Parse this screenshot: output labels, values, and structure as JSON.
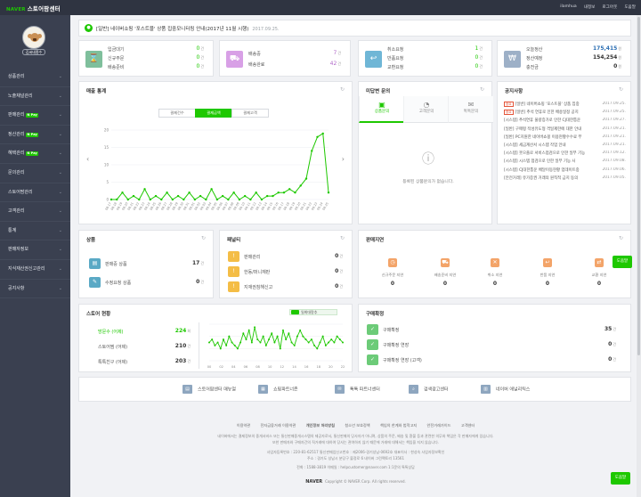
{
  "header": {
    "brand_logo": "NAVER",
    "app_title": "스토어팜센터",
    "user_id": "ilamhua",
    "links": [
      "내정보",
      "로그아웃",
      "도움말"
    ]
  },
  "sidebar": {
    "shop_name": "김씨네종수",
    "items": [
      {
        "label": "상품관리",
        "pay": ""
      },
      {
        "label": "노출채널관리",
        "pay": ""
      },
      {
        "label": "판매관리",
        "pay": "N Pay"
      },
      {
        "label": "정산관리",
        "pay": "N Pay"
      },
      {
        "label": "혜택관리",
        "pay": "N Pay"
      },
      {
        "label": "문의관리",
        "pay": ""
      },
      {
        "label": "스토어팜관리",
        "pay": ""
      },
      {
        "label": "고객관리",
        "pay": ""
      },
      {
        "label": "통계",
        "pay": ""
      },
      {
        "label": "판매자정보",
        "pay": ""
      },
      {
        "label": "지식재산권신고관리",
        "pay": ""
      },
      {
        "label": "공지사항",
        "pay": ""
      }
    ]
  },
  "notice": {
    "icon": "bell-icon",
    "text": "[일반] 네이버쇼핑 '포스트블' 상품 집중모니터링 안내(2017년 11월 시행)",
    "date": "2017.09.25."
  },
  "summary": {
    "orders": {
      "icon": "hourglass-icon",
      "color": "#7fbf9c",
      "rows": [
        {
          "label": "입금대기",
          "value": "0",
          "unit": "건"
        },
        {
          "label": "신규주문",
          "value": "0",
          "unit": "건"
        },
        {
          "label": "배송준비",
          "value": "0",
          "unit": "건"
        }
      ]
    },
    "shipping": {
      "icon": "truck-icon",
      "color": "#d8a0e6",
      "rows": [
        {
          "label": "배송중",
          "value": "7",
          "unit": "건"
        },
        {
          "label": "배송완료",
          "value": "42",
          "unit": "건"
        }
      ]
    },
    "claims": {
      "icon": "return-icon",
      "color": "#6fb6d6",
      "rows": [
        {
          "label": "취소요청",
          "value": "1",
          "unit": "건"
        },
        {
          "label": "반품요청",
          "value": "0",
          "unit": "건"
        },
        {
          "label": "교환요청",
          "value": "0",
          "unit": "건"
        }
      ]
    },
    "settlement": {
      "icon": "won-icon",
      "color": "#9db0c7",
      "rows": [
        {
          "label": "오늘정산",
          "value": "175,415",
          "unit": "원"
        },
        {
          "label": "정산예정",
          "value": "154,254",
          "unit": "원"
        },
        {
          "label": "충전금",
          "value": "0",
          "unit": "원"
        }
      ]
    }
  },
  "sales_stats": {
    "title": "매출 통계",
    "tabs": [
      "결제건수",
      "결제금액",
      "결제고객"
    ],
    "active_tab": 1
  },
  "chart_data": {
    "type": "line",
    "title": "매출 통계",
    "x": [
      "08.17",
      "08.18",
      "08.19",
      "08.20",
      "08.21",
      "08.22",
      "08.23",
      "08.24",
      "08.25",
      "08.26",
      "08.27",
      "08.28",
      "08.29",
      "08.30",
      "08.31",
      "09.01",
      "09.02",
      "09.03",
      "09.04",
      "09.05",
      "09.06",
      "09.07",
      "09.08",
      "09.09",
      "09.10",
      "09.11",
      "09.12",
      "09.13",
      "09.14",
      "09.15",
      "09.16",
      "09.17",
      "09.18",
      "09.19",
      "09.20",
      "09.21",
      "09.22",
      "09.23",
      "09.24",
      "09.25"
    ],
    "series": [
      {
        "values": [
          0,
          0,
          2,
          0,
          1,
          0,
          3,
          0,
          1,
          0,
          2,
          0,
          1,
          0,
          2,
          0,
          1,
          0,
          3,
          0,
          1,
          0,
          2,
          0,
          1,
          0,
          2,
          0,
          1,
          1,
          2,
          2,
          3,
          2,
          4,
          6,
          14,
          18,
          19,
          2
        ]
      }
    ],
    "ylim": [
      0,
      20
    ],
    "yticks": [
      0,
      5,
      10,
      15,
      20
    ],
    "color": "#1ec800"
  },
  "inquiries": {
    "title": "미답변 문의",
    "tabs": [
      "상품문의",
      "고객문의",
      "톡톡문의"
    ],
    "tab_icons": [
      "box-icon",
      "chat-icon",
      "talk-icon"
    ],
    "empty_text": "등록된 상품문의가 없습니다."
  },
  "announcements": {
    "title": "공지사항",
    "items": [
      {
        "tag": "중요",
        "text": "[일반] 네이버쇼핑 '포스트블' 상품 집중",
        "date": "2017.09.25."
      },
      {
        "tag": "중요",
        "text": "[일반] 추석 연휴로 인한 배송일정 공지",
        "date": "2017.09.25."
      },
      {
        "tag": "",
        "text": "[시스템] 추석연휴 물량증가로 인한 CJ대한통운",
        "date": "2017.09.27."
      },
      {
        "tag": "",
        "text": "[일반] 구매평 작성유도형 격일제한에 대한 안내",
        "date": "2017.09.21."
      },
      {
        "tag": "",
        "text": "[일반] PC지원한 네이버쇼핑 이용현황수수료 부",
        "date": "2017.09.21."
      },
      {
        "tag": "",
        "text": "[시스템] 세금계산서 시스템 작업 안내",
        "date": "2017.09.21."
      },
      {
        "tag": "",
        "text": "[시스템] 웃으플로 서비스점검으로 인한 일부 기능",
        "date": "2017.09.12."
      },
      {
        "tag": "",
        "text": "[시스템] 시스템 점검으로 인한 일부 기능 사",
        "date": "2017.09.08."
      },
      {
        "tag": "",
        "text": "[시스템] CJ대한통운 배달이동현황 업데이트중",
        "date": "2017.09.06."
      },
      {
        "tag": "",
        "text": "[안전거래] 유가증권 거래의 원칙적 금지 동의",
        "date": "2017.09.05."
      }
    ]
  },
  "products": {
    "title": "상품",
    "rows": [
      {
        "label": "판매중 상품",
        "value": "17",
        "unit": "건"
      },
      {
        "label": "수정요청 상품",
        "value": "0",
        "unit": "건"
      }
    ]
  },
  "penalty": {
    "title": "패널티",
    "rows": [
      {
        "label": "판매관리",
        "value": "0",
        "unit": "건"
      },
      {
        "label": "한동/퍼니재판",
        "value": "0",
        "unit": "건"
      },
      {
        "label": "지재권침해신고",
        "value": "0",
        "unit": "건"
      }
    ]
  },
  "delays": {
    "title": "판매지연",
    "items": [
      {
        "label": "신규주문 지연",
        "value": "0",
        "icon": "clock-icon"
      },
      {
        "label": "배송준비 지연",
        "value": "0",
        "icon": "truck-icon"
      },
      {
        "label": "취소 지연",
        "value": "0",
        "icon": "cancel-icon"
      },
      {
        "label": "반품 지연",
        "value": "0",
        "icon": "return-icon"
      },
      {
        "label": "교환 지연",
        "value": "0",
        "icon": "exchange-icon"
      }
    ],
    "chat_button": "도움말"
  },
  "store_status": {
    "title": "스토어 현황",
    "toggle_label": "일최대량추",
    "rows": [
      {
        "label": "방문수 (어제)",
        "value": "224",
        "unit": "회"
      },
      {
        "label": "스토어찜 (어제)",
        "value": "210",
        "unit": "건"
      },
      {
        "label": "톡톡친구 (어제)",
        "value": "203",
        "unit": "건"
      }
    ]
  },
  "visit_chart": {
    "x": [
      "00",
      "02",
      "04",
      "06",
      "08",
      "10",
      "12",
      "14",
      "16",
      "18",
      "20",
      "22"
    ],
    "values": [
      6,
      7,
      5,
      6,
      4,
      7,
      5,
      8,
      6,
      5,
      4,
      6,
      9,
      7,
      10,
      6,
      11,
      7,
      6,
      8,
      5,
      7,
      9,
      6,
      8,
      4,
      10,
      7,
      9,
      6,
      5,
      8,
      10,
      8,
      7,
      6,
      7,
      5,
      4,
      6,
      8,
      5,
      6,
      7,
      6,
      8,
      7,
      6
    ],
    "color": "#1ec800"
  },
  "purchase_confirm": {
    "title": "구매확정",
    "rows": [
      {
        "label": "구매확정",
        "value": "35",
        "unit": "건"
      },
      {
        "label": "구매확정 연장",
        "value": "0",
        "unit": "건"
      },
      {
        "label": "구매확정 연장 (고객)",
        "value": "0",
        "unit": "건"
      }
    ]
  },
  "quick_links": [
    {
      "label": "스토어팜센터 매뉴얼",
      "icon": "book-icon"
    },
    {
      "label": "쇼핑파트너존",
      "icon": "partner-icon"
    },
    {
      "label": "톡톡 파트너센터",
      "icon": "talk-icon"
    },
    {
      "label": "검색광고센터",
      "icon": "search-ad-icon"
    },
    {
      "label": "네이버 애널리틱스",
      "icon": "analytics-icon"
    }
  ],
  "footer": {
    "links": [
      "이용약관",
      "전자금융거래 이용약관",
      "개인정보 처리방침",
      "청소년 보호정책",
      "책임의 한계와 법적고지",
      "안전거래가이드",
      "고객센터"
    ],
    "disclaimer1": "네이버에서는 결제정보의 중개서비스 또는 통신판매중개시스템의 제공자로서, 통신판매의 당사자가 아니며, 상품의 주문, 배송 및 환불 등과 관련한 의무와 책임은 각 판매자에게 있습니다.",
    "disclaimer2": "또한 판매자와 구매자간의 직거래에 대하여 당사는 관여하지 않기 때문에 거래에 대해서는 책임을 지지 않습니다.",
    "business": "사업자등록번호 : 220-81-62517   통신판매업신고번호 : 제2006-경기성남-0692호   대표이사 : 한성숙   사업자정보확인",
    "address": "주소 : 경기도 성남시 분당구 불정로 6 네이버 그린팩토리 13561",
    "contact": "전화 : 1588-3819   이메일 : helpcustomer@naver.com   1:1문의   톡톡상담",
    "copyright": "Copyright © NAVER Corp. All rights reserved.",
    "naver": "NAVER",
    "chat_button": "도움말"
  }
}
